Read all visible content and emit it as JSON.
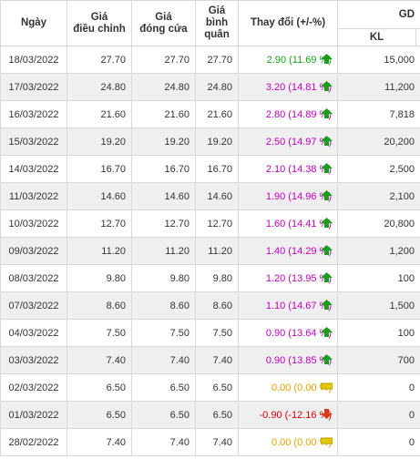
{
  "header": {
    "date": "Ngày",
    "adjusted": "Giá\nđiều chỉnh",
    "close": "Giá\nđóng cửa",
    "average": "Giá\nbình\nquân",
    "change": "Thay đổi (+/-%)",
    "gd": "GD",
    "kl": "KL"
  },
  "rows": [
    {
      "date": "18/03/2022",
      "adj": "27.70",
      "close": "27.70",
      "avg": "27.70",
      "change": "2.90 (11.69 %)",
      "style": "up",
      "icon": "arrow-up-icon",
      "vol": "15,000"
    },
    {
      "date": "17/03/2022",
      "adj": "24.80",
      "close": "24.80",
      "avg": "24.80",
      "change": "3.20 (14.81 %)",
      "style": "mag",
      "icon": "arrow-up-icon",
      "vol": "11,200"
    },
    {
      "date": "16/03/2022",
      "adj": "21.60",
      "close": "21.60",
      "avg": "21.60",
      "change": "2.80 (14.89 %)",
      "style": "mag",
      "icon": "arrow-up-icon",
      "vol": "7,818"
    },
    {
      "date": "15/03/2022",
      "adj": "19.20",
      "close": "19.20",
      "avg": "19.20",
      "change": "2.50 (14.97 %)",
      "style": "mag",
      "icon": "arrow-up-icon",
      "vol": "20,200"
    },
    {
      "date": "14/03/2022",
      "adj": "16.70",
      "close": "16.70",
      "avg": "16.70",
      "change": "2.10 (14.38 %)",
      "style": "mag",
      "icon": "arrow-up-icon",
      "vol": "2,500"
    },
    {
      "date": "11/03/2022",
      "adj": "14.60",
      "close": "14.60",
      "avg": "14.60",
      "change": "1.90 (14.96 %)",
      "style": "mag",
      "icon": "arrow-up-icon",
      "vol": "2,100"
    },
    {
      "date": "10/03/2022",
      "adj": "12.70",
      "close": "12.70",
      "avg": "12.70",
      "change": "1.60 (14.41 %)",
      "style": "mag",
      "icon": "arrow-up-icon",
      "vol": "20,800"
    },
    {
      "date": "09/03/2022",
      "adj": "11.20",
      "close": "11.20",
      "avg": "11.20",
      "change": "1.40 (14.29 %)",
      "style": "mag",
      "icon": "arrow-up-icon",
      "vol": "1,200"
    },
    {
      "date": "08/03/2022",
      "adj": "9.80",
      "close": "9.80",
      "avg": "9.80",
      "change": "1.20 (13.95 %)",
      "style": "mag",
      "icon": "arrow-up-icon",
      "vol": "100"
    },
    {
      "date": "07/03/2022",
      "adj": "8.60",
      "close": "8.60",
      "avg": "8.60",
      "change": "1.10 (14.67 %)",
      "style": "mag",
      "icon": "arrow-up-icon",
      "vol": "1,500"
    },
    {
      "date": "04/03/2022",
      "adj": "7.50",
      "close": "7.50",
      "avg": "7.50",
      "change": "0.90 (13.64 %)",
      "style": "mag",
      "icon": "arrow-up-icon",
      "vol": "100"
    },
    {
      "date": "03/03/2022",
      "adj": "7.40",
      "close": "7.40",
      "avg": "7.40",
      "change": "0.90 (13.85 %)",
      "style": "mag",
      "icon": "arrow-up-icon",
      "vol": "700"
    },
    {
      "date": "02/03/2022",
      "adj": "6.50",
      "close": "6.50",
      "avg": "6.50",
      "change": "0.00 (0.00 %)",
      "style": "flat",
      "icon": "flat-icon",
      "vol": "0"
    },
    {
      "date": "01/03/2022",
      "adj": "6.50",
      "close": "6.50",
      "avg": "6.50",
      "change": "-0.90 (-12.16 %)",
      "style": "down",
      "icon": "arrow-down-icon",
      "vol": "0"
    },
    {
      "date": "28/02/2022",
      "adj": "7.40",
      "close": "7.40",
      "avg": "7.40",
      "change": "0.00 (0.00 %)",
      "style": "flat",
      "icon": "flat-icon",
      "vol": "0"
    }
  ],
  "colors": {
    "up": "#18a818",
    "magenta": "#c000c0",
    "flat": "#e3c900",
    "down": "#d40000"
  }
}
